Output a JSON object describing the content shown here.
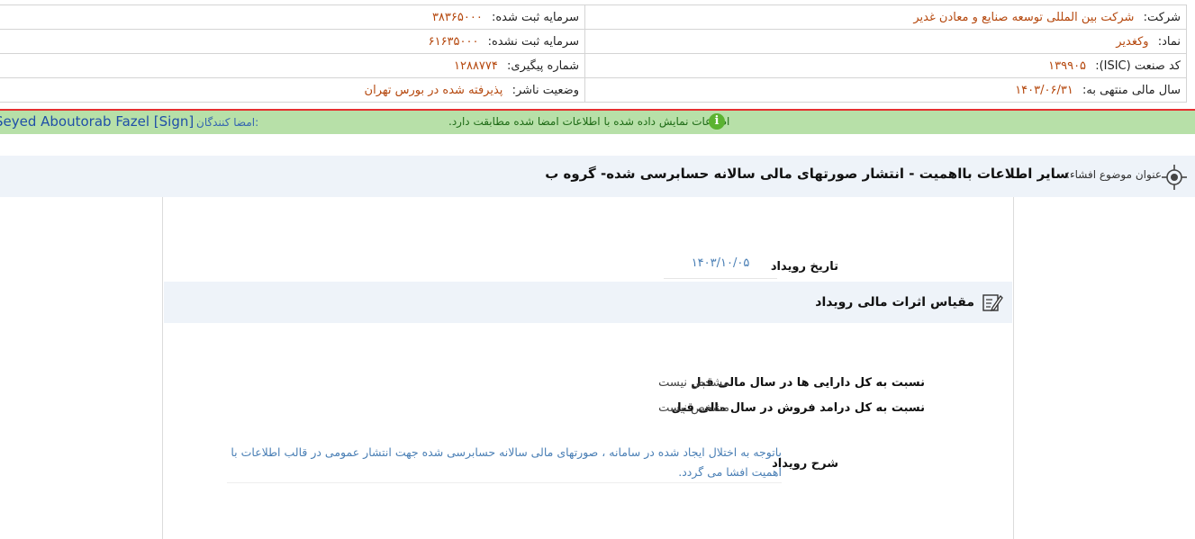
{
  "company_info": {
    "company_label": "شرکت:",
    "company_value": "شرکت بین المللی توسعه صنایع و معادن غدیر",
    "symbol_label": "نماد:",
    "symbol_value": "وکغدیر",
    "isic_label": "کد صنعت (ISIC):",
    "isic_value": "۱۳۹۹۰۵",
    "fiscal_year_label": "سال مالی منتهی به:",
    "fiscal_year_value": "۱۴۰۳/۰۶/۳۱",
    "registered_capital_label": "سرمایه ثبت شده:",
    "registered_capital_value": "۳۸۳۶۵۰۰۰",
    "unregistered_capital_label": "سرمایه ثبت نشده:",
    "unregistered_capital_value": "۶۱۶۳۵۰۰۰",
    "tracking_label": "شماره پیگیری:",
    "tracking_value": "۱۲۸۸۷۷۴",
    "publisher_status_label": "وضعیت ناشر:",
    "publisher_status_value": "پذیرفته شده در بورس تهران"
  },
  "signature_bar": {
    "signers_label": "امضا کنندگان:",
    "signers_value": "Seyed Aboutorab Fazel [Sign]",
    "verify_text": "اطلاعات نمایش داده شده با اطلاعات امضا شده مطابقت دارد.",
    "info_icon_glyph": "i",
    "info_icon": "info-circle-icon"
  },
  "title_bar": {
    "label": "عنوان موضوع افشاء:",
    "title": "سایر اطلاعات بااهمیت - انتشار صورتهای مالی سالانه حسابرسی شده- گروه ب",
    "icon": "crosshair-icon"
  },
  "event": {
    "date_label": "تاریخ رویداد",
    "date_value": "۱۴۰۳/۱۰/۰۵"
  },
  "financial_effects": {
    "heading": "مقیاس اثرات مالی رویداد",
    "icon": "edit-note-icon",
    "assets_label": "نسبت به کل دارایی ها در سال مالی قبل",
    "assets_value": "مشخص نیست",
    "revenue_label": "نسبت به کل درامد فروش در سال مالی قبل",
    "revenue_value": "مشخص نیست"
  },
  "description": {
    "label": "شرح رویداد",
    "text": "باتوجه به اختلال ایجاد شده در سامانه ، صورتهای مالی سالانه حسابرسی شده جهت انتشار عمومی در قالب اطلاعات با اهمیت افشا می گردد."
  },
  "colors": {
    "value_orange": "#b5480e",
    "link_blue": "#4a7fb5",
    "signature_green": "#b7e0a8",
    "alert_red": "#e53030",
    "section_bg": "#eef3f9"
  }
}
